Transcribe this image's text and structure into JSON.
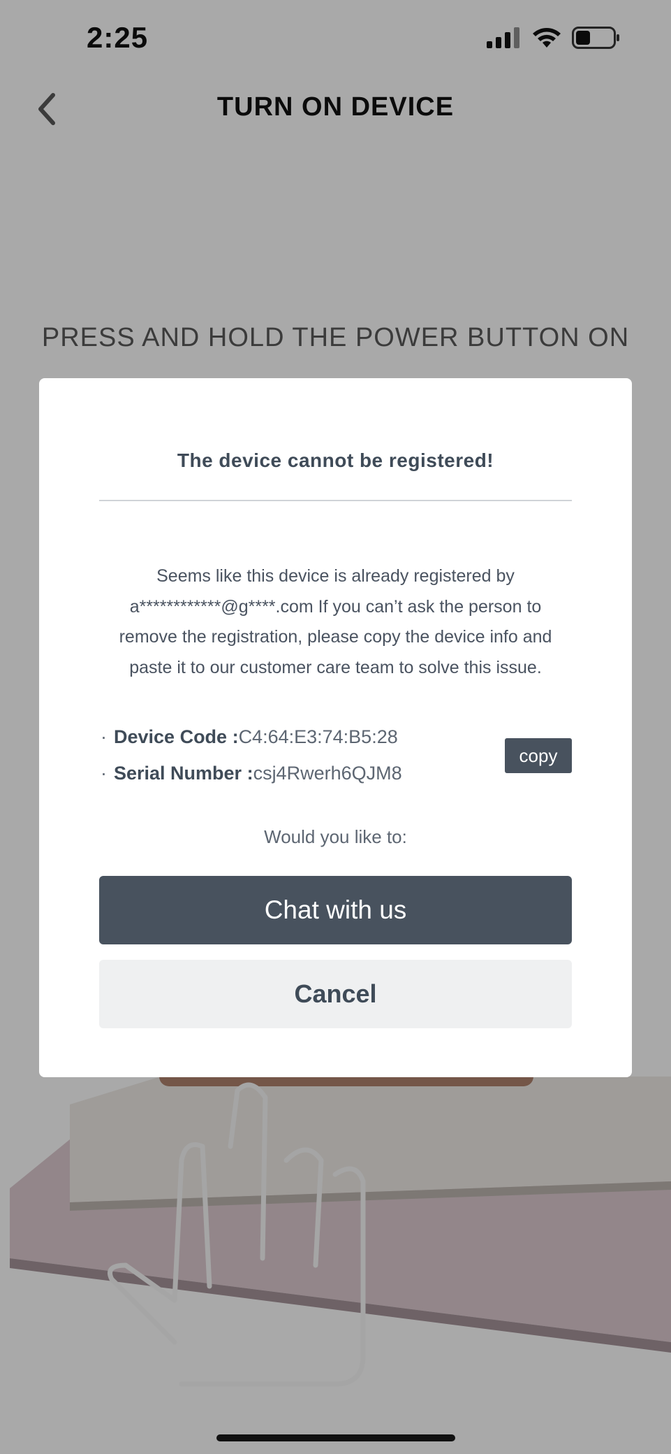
{
  "status_bar": {
    "time": "2:25"
  },
  "nav": {
    "title": "TURN ON DEVICE",
    "back_icon": "chevron-left-icon"
  },
  "instruction": "PRESS AND HOLD THE POWER BUTTON ON",
  "dialog": {
    "title": "The device cannot be registered!",
    "message": "Seems like this device is already registered by a************@g****.com If you can’t ask the person to remove the registration, please copy the device info and paste it to our customer care team to solve this issue.",
    "device_code_label": "Device Code :",
    "device_code_value": "C4:64:E3:74:B5:28",
    "serial_label": "Serial Number :",
    "serial_value": "csj4Rwerh6QJM8",
    "bullet": "·",
    "copy_label": "copy",
    "prompt": "Would you like to:",
    "chat_label": "Chat with us",
    "cancel_label": "Cancel"
  },
  "colors": {
    "primary": "#48525e",
    "overlay": "rgba(0,0,0,0.30)",
    "secondary_button": "#eff0f1"
  }
}
